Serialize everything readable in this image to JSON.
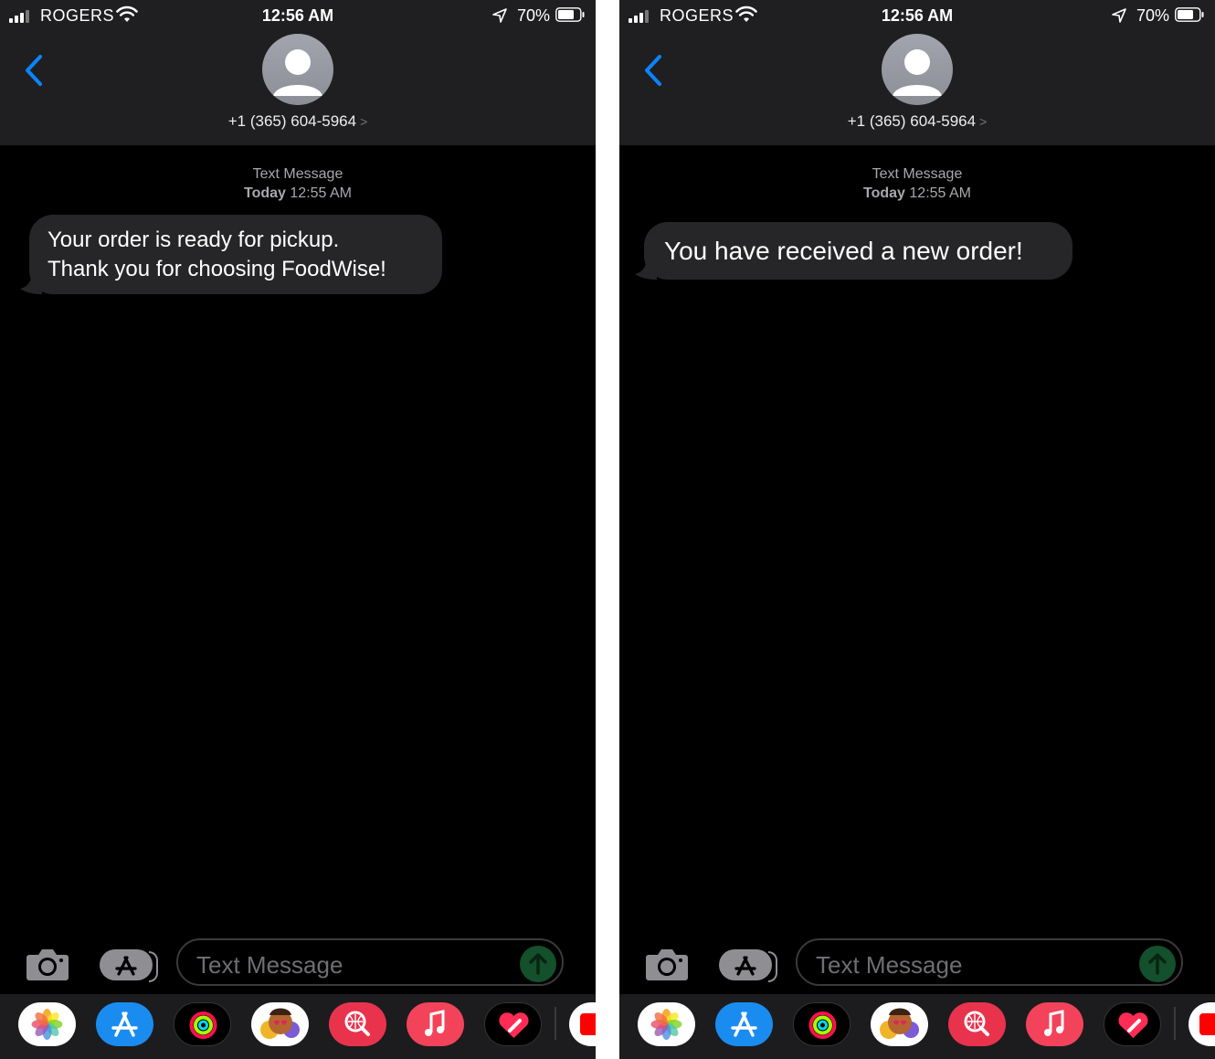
{
  "colors": {
    "header_bg": "#1f1f21",
    "bubble_bg": "#262628",
    "accent_blue": "#0a84ff",
    "send_green_disabled": "#13502b",
    "dock_bg": "#1c1c1e"
  },
  "screens": [
    {
      "status": {
        "carrier": "ROGERS",
        "time": "12:56 AM",
        "battery": "70%"
      },
      "contact": {
        "number": "+1 (365) 604-5964",
        "chevron": ">"
      },
      "thread": {
        "meta_title": "Text Message",
        "meta_day": "Today",
        "meta_time": "12:55 AM",
        "message_line1": "Your order is ready for pickup.",
        "message_line2": "Thank you for choosing FoodWise!"
      },
      "composer": {
        "placeholder": "Text Message"
      }
    },
    {
      "status": {
        "carrier": "ROGERS",
        "time": "12:56 AM",
        "battery": "70%"
      },
      "contact": {
        "number": "+1 (365) 604-5964",
        "chevron": ">"
      },
      "thread": {
        "meta_title": "Text Message",
        "meta_day": "Today",
        "meta_time": "12:55 AM",
        "message": "You have received a new order!"
      },
      "composer": {
        "placeholder": "Text Message"
      }
    }
  ],
  "dock_icons": [
    "photos-icon",
    "app-store-icon",
    "activity-icon",
    "memoji-icon",
    "images-search-icon",
    "music-icon",
    "heart-sticker-icon",
    "more-apps-icon"
  ]
}
